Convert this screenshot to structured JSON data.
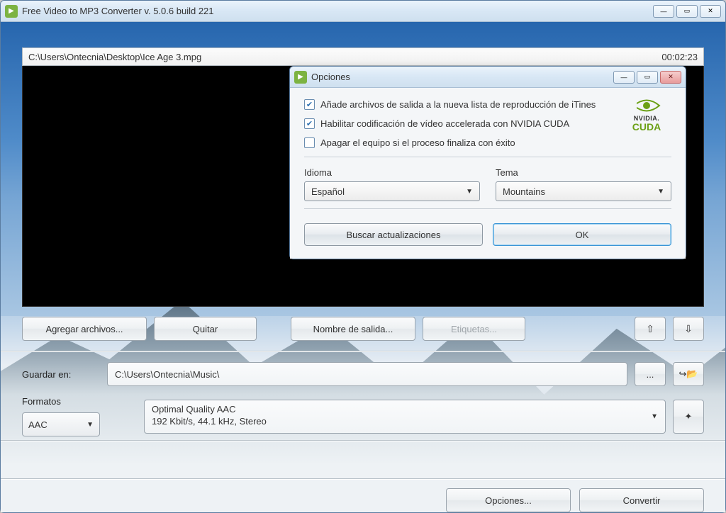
{
  "main": {
    "title": "Free Video to MP3 Converter  v. 5.0.6 build 221",
    "file_path": "C:\\Users\\Ontecnia\\Desktop\\Ice Age 3.mpg",
    "duration": "00:02:23",
    "buttons": {
      "add_files": "Agregar archivos...",
      "remove": "Quitar",
      "output_name": "Nombre de salida...",
      "tags": "Etiquetas..."
    },
    "save_to_label": "Guardar en:",
    "save_to_path": "C:\\Users\\Ontecnia\\Music\\",
    "browse": "...",
    "formats_label": "Formatos",
    "format_value": "AAC",
    "quality_line1": "Optimal Quality AAC",
    "quality_line2": "192 Kbit/s, 44.1 kHz, Stereo",
    "options_btn": "Opciones...",
    "convert_btn": "Convertir"
  },
  "dialog": {
    "title": "Opciones",
    "opt1": "Añade archivos de salida a la nueva lista de reproducción de iTines",
    "opt2": "Habilitar codificación de vídeo accelerada con NVIDIA CUDA",
    "opt3": "Apagar el equipo si el proceso finaliza con éxito",
    "nvidia_top": "NVIDIA.",
    "nvidia_bottom": "CUDA",
    "language_label": "Idioma",
    "language_value": "Español",
    "theme_label": "Tema",
    "theme_value": "Mountains",
    "check_updates": "Buscar actualizaciones",
    "ok": "OK"
  }
}
